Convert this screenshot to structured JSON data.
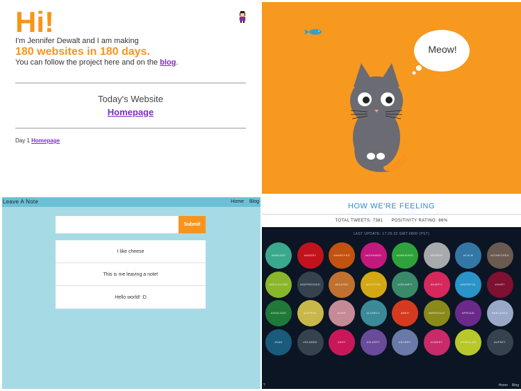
{
  "q1": {
    "greeting": "Hi!",
    "intro": "I'm Jennifer Dewalt and I am making",
    "headline": "180 websites in 180 days.",
    "follow_prefix": "You can follow the project here and on the ",
    "follow_link": "blog",
    "follow_suffix": ".",
    "today_label": "Today's Website",
    "today_link": "Homepage",
    "day_label": "Day 1",
    "day_link": "Homepage",
    "accent": "#f7941d",
    "link_color": "#7a2fbf"
  },
  "q2": {
    "speech": "Meow!",
    "background": "#f7981f"
  },
  "q3": {
    "brand": "Leave A Note",
    "nav": [
      "Home",
      "Blog"
    ],
    "input_value": "",
    "submit_label": "Submit",
    "notes": [
      "I like cheese",
      "This is me leaving a note!",
      "Hello world! :D"
    ]
  },
  "q4": {
    "title": "HOW WE'RE FEELING",
    "total_label": "TOTAL TWEETS: 7381",
    "positivity_label": "POSITIVITY RATING: 86%",
    "updated": "LAST UPDATE: 17:26:32 GMT-0800 (PST)",
    "footer_nav": [
      "Home",
      "Blog"
    ],
    "footer_q": "?",
    "feelings": [
      {
        "tag": "#AMAZED",
        "color": "#3aa88c"
      },
      {
        "tag": "#ANGRY",
        "color": "#c0131d"
      },
      {
        "tag": "#ANNOYED",
        "color": "#c2520f"
      },
      {
        "tag": "#ASHAMED",
        "color": "#c3187c"
      },
      {
        "tag": "#AWKWARD",
        "color": "#2fa23c"
      },
      {
        "tag": "#BORED",
        "color": "#a7a9ad"
      },
      {
        "tag": "#CALM",
        "color": "#3377a6"
      },
      {
        "tag": "#CONFUSED",
        "color": "#6b5a50"
      },
      {
        "tag": "#DELIGHTED",
        "color": "#8ab62b"
      },
      {
        "tag": "#DEPRESSED",
        "color": "#36424e"
      },
      {
        "tag": "#ELATED",
        "color": "#c0702f"
      },
      {
        "tag": "#EXCITED",
        "color": "#d3a814"
      },
      {
        "tag": "#GRUMPY",
        "color": "#3a8a6a"
      },
      {
        "tag": "#HAPPY",
        "color": "#d6285c"
      },
      {
        "tag": "#HOPEFUL",
        "color": "#2a93c8"
      },
      {
        "tag": "#HURT",
        "color": "#7e1030"
      },
      {
        "tag": "#JEALOUS",
        "color": "#1f7a3a"
      },
      {
        "tag": "#JOYFUL",
        "color": "#c8b84a"
      },
      {
        "tag": "#LIKE",
        "color": "#c68a96"
      },
      {
        "tag": "#LONELY",
        "color": "#3a8a9a"
      },
      {
        "tag": "#MEH",
        "color": "#d63a1e"
      },
      {
        "tag": "#NERVOUS",
        "color": "#8a8a1a"
      },
      {
        "tag": "#PROUD",
        "color": "#6a2a8a"
      },
      {
        "tag": "#RELAXED",
        "color": "#9aa8c8"
      },
      {
        "tag": "#SAD",
        "color": "#1a5a7a"
      },
      {
        "tag": "#SCARED",
        "color": "#36424e"
      },
      {
        "tag": "#SHY",
        "color": "#c8185a"
      },
      {
        "tag": "#SLEEPY",
        "color": "#6a4a9a"
      },
      {
        "tag": "#SORRY",
        "color": "#6a7aa8"
      },
      {
        "tag": "#SWEET",
        "color": "#c82a6a"
      },
      {
        "tag": "#THRILLED",
        "color": "#b8c82a"
      },
      {
        "tag": "#UPSET",
        "color": "#36424e"
      }
    ]
  }
}
